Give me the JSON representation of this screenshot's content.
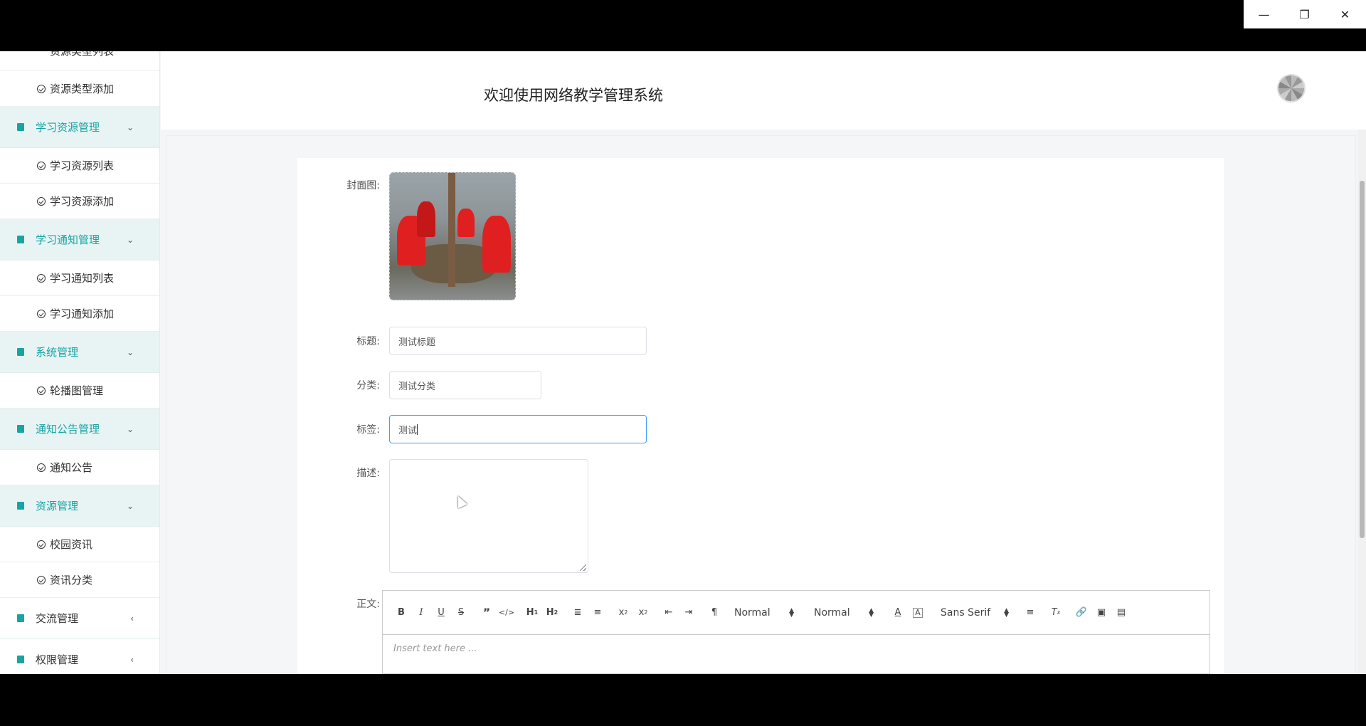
{
  "window": {
    "minimize_icon": "minimize-icon",
    "restore_icon": "restore-icon",
    "close_icon": "close-icon"
  },
  "header": {
    "title": "欢迎使用网络教学管理系统"
  },
  "sidebar": {
    "cut_item": "资源类型列表",
    "items": [
      {
        "type": "item",
        "label": "资源类型添加"
      },
      {
        "type": "group",
        "label": "学习资源管理",
        "expanded": true
      },
      {
        "type": "item",
        "label": "学习资源列表"
      },
      {
        "type": "item",
        "label": "学习资源添加"
      },
      {
        "type": "group",
        "label": "学习通知管理",
        "expanded": true
      },
      {
        "type": "item",
        "label": "学习通知列表"
      },
      {
        "type": "item",
        "label": "学习通知添加"
      },
      {
        "type": "group",
        "label": "系统管理",
        "expanded": true
      },
      {
        "type": "item",
        "label": "轮播图管理"
      },
      {
        "type": "group",
        "label": "通知公告管理",
        "expanded": true
      },
      {
        "type": "item",
        "label": "通知公告"
      },
      {
        "type": "group",
        "label": "资源管理",
        "expanded": true
      },
      {
        "type": "item",
        "label": "校园资讯"
      },
      {
        "type": "item",
        "label": "资讯分类"
      },
      {
        "type": "group",
        "label": "交流管理",
        "expanded": false
      },
      {
        "type": "group",
        "label": "权限管理",
        "expanded": false
      }
    ]
  },
  "form": {
    "cover_label": "封面图:",
    "title_label": "标题:",
    "title_value": "测试标题",
    "category_label": "分类:",
    "category_value": "测试分类",
    "tag_label": "标签:",
    "tag_value": "测试",
    "desc_label": "描述:",
    "desc_value": "",
    "body_label": "正文:"
  },
  "editor": {
    "header_select": "Normal",
    "size_select": "Normal",
    "font_select": "Sans Serif",
    "placeholder": "Insert text here ..."
  },
  "colors": {
    "accent": "#19a3a3",
    "group_bg": "#e8f4f4",
    "focus_border": "#409eff"
  }
}
